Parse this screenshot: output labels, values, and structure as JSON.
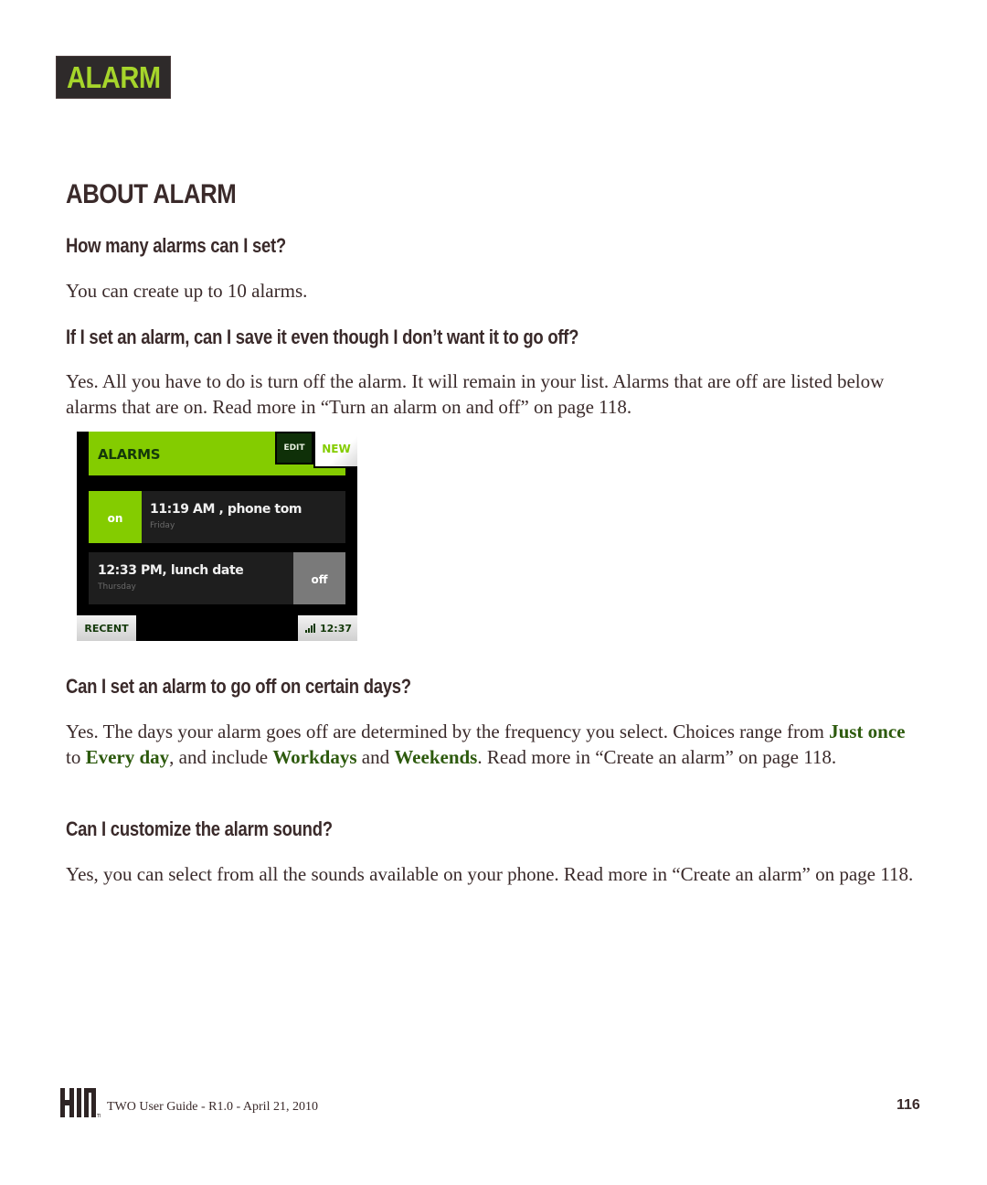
{
  "chapter_tab": "ALARM",
  "section_title": "ABOUT ALARM",
  "faq": [
    {
      "question": "How many alarms can I set?",
      "answer": "You can create up to 10 alarms."
    },
    {
      "question": "If I set an alarm, can I save it even though I don’t want it to go off?",
      "answer": "Yes. All you have to do is turn off the alarm. It will remain in your list. Alarms that are off are listed below alarms that are on. Read more in “Turn an alarm on and off” on page 118."
    },
    {
      "question": "Can I set an alarm to go off on certain days?",
      "answer_parts": {
        "p1": "Yes. The days your alarm goes off are determined by the frequency you select. Choices range from ",
        "opt1": "Just once",
        "p2": " to ",
        "opt2": "Every day",
        "p3": ", and include ",
        "opt3": "Workdays",
        "p4": " and ",
        "opt4": "Weekends",
        "p5": ". Read more in “Create an alarm” on page 118."
      }
    },
    {
      "question": "Can I customize the alarm sound?",
      "answer": "Yes, you can select from all the sounds available on your phone. Read more in “Create an alarm” on page 118."
    }
  ],
  "phone_screen": {
    "title": "ALARMS",
    "edit_label": "EDIT",
    "new_label": "NEW",
    "alarms": [
      {
        "state": "on",
        "time": "11:19 AM , phone tom",
        "day": "Friday"
      },
      {
        "state": "off",
        "time": "12:33 PM, lunch date",
        "day": "Thursday"
      }
    ],
    "recent_label": "RECENT",
    "clock": "12:37",
    "signal_icon": "signal-bars-icon",
    "accent_color": "#84cc00"
  },
  "footer": {
    "logo": "KIN",
    "doc_info": "TWO User Guide - R1.0 - April 21, 2010",
    "page_number": "116"
  }
}
